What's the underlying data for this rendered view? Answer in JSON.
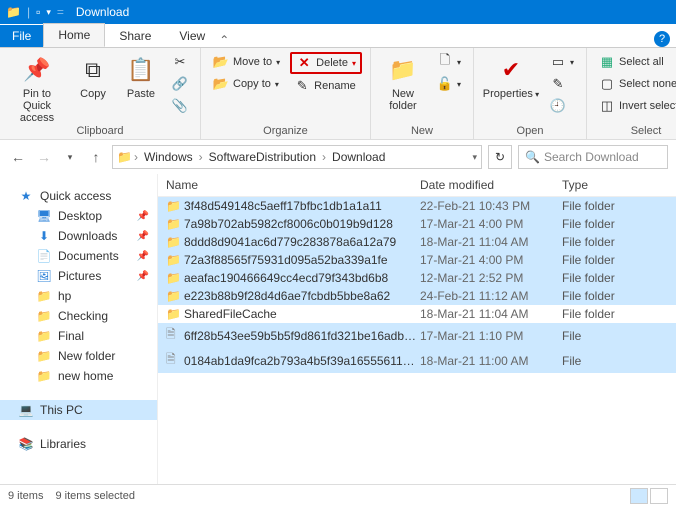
{
  "titlebar": {
    "title": "Download"
  },
  "tabs": {
    "file": "File",
    "home": "Home",
    "share": "Share",
    "view": "View"
  },
  "ribbon": {
    "clipboard": {
      "label": "Clipboard",
      "pin": "Pin to Quick\naccess",
      "copy": "Copy",
      "paste": "Paste"
    },
    "organize": {
      "label": "Organize",
      "move": "Move to",
      "copy": "Copy to",
      "delete": "Delete",
      "rename": "Rename"
    },
    "new": {
      "label": "New",
      "folder": "New\nfolder"
    },
    "open": {
      "label": "Open",
      "properties": "Properties"
    },
    "select": {
      "label": "Select",
      "all": "Select all",
      "none": "Select none",
      "invert": "Invert selection"
    }
  },
  "address": {
    "crumbs": [
      "Windows",
      "SoftwareDistribution",
      "Download"
    ]
  },
  "search": {
    "placeholder": "Search Download"
  },
  "nav": {
    "quick": "Quick access",
    "desktop": "Desktop",
    "downloads": "Downloads",
    "documents": "Documents",
    "pictures": "Pictures",
    "hp": "hp",
    "checking": "Checking",
    "final": "Final",
    "newfolder": "New folder",
    "newhome": "new home",
    "thispc": "This PC",
    "libraries": "Libraries"
  },
  "columns": {
    "name": "Name",
    "date": "Date modified",
    "type": "Type"
  },
  "rows": [
    {
      "name": "3f48d549148c5aeff17bfbc1db1a1a11",
      "date": "22-Feb-21 10:43 PM",
      "type": "File folder",
      "sel": true,
      "kind": "folder"
    },
    {
      "name": "7a98b702ab5982cf8006c0b019b9d128",
      "date": "17-Mar-21 4:00 PM",
      "type": "File folder",
      "sel": true,
      "kind": "folder"
    },
    {
      "name": "8ddd8d9041ac6d779c283878a6a12a79",
      "date": "18-Mar-21 11:04 AM",
      "type": "File folder",
      "sel": true,
      "kind": "folder"
    },
    {
      "name": "72a3f88565f75931d095a52ba339a1fe",
      "date": "17-Mar-21 4:00 PM",
      "type": "File folder",
      "sel": true,
      "kind": "folder"
    },
    {
      "name": "aeafac190466649cc4ecd79f343bd6b8",
      "date": "12-Mar-21 2:52 PM",
      "type": "File folder",
      "sel": true,
      "kind": "folder"
    },
    {
      "name": "e223b88b9f28d4d6ae7fcbdb5bbe8a62",
      "date": "24-Feb-21 11:12 AM",
      "type": "File folder",
      "sel": true,
      "kind": "folder"
    },
    {
      "name": "SharedFileCache",
      "date": "18-Mar-21 11:04 AM",
      "type": "File folder",
      "sel": false,
      "kind": "folder"
    },
    {
      "name": "6ff28b543ee59b5b5f9d861fd321be16adb8...",
      "date": "17-Mar-21 1:10 PM",
      "type": "File",
      "sel": true,
      "kind": "file"
    },
    {
      "name": "0184ab1da9fca2b793a4b5f39a1655561108...",
      "date": "18-Mar-21 11:00 AM",
      "type": "File",
      "sel": true,
      "kind": "file"
    }
  ],
  "status": {
    "items": "9 items",
    "selected": "9 items selected"
  }
}
